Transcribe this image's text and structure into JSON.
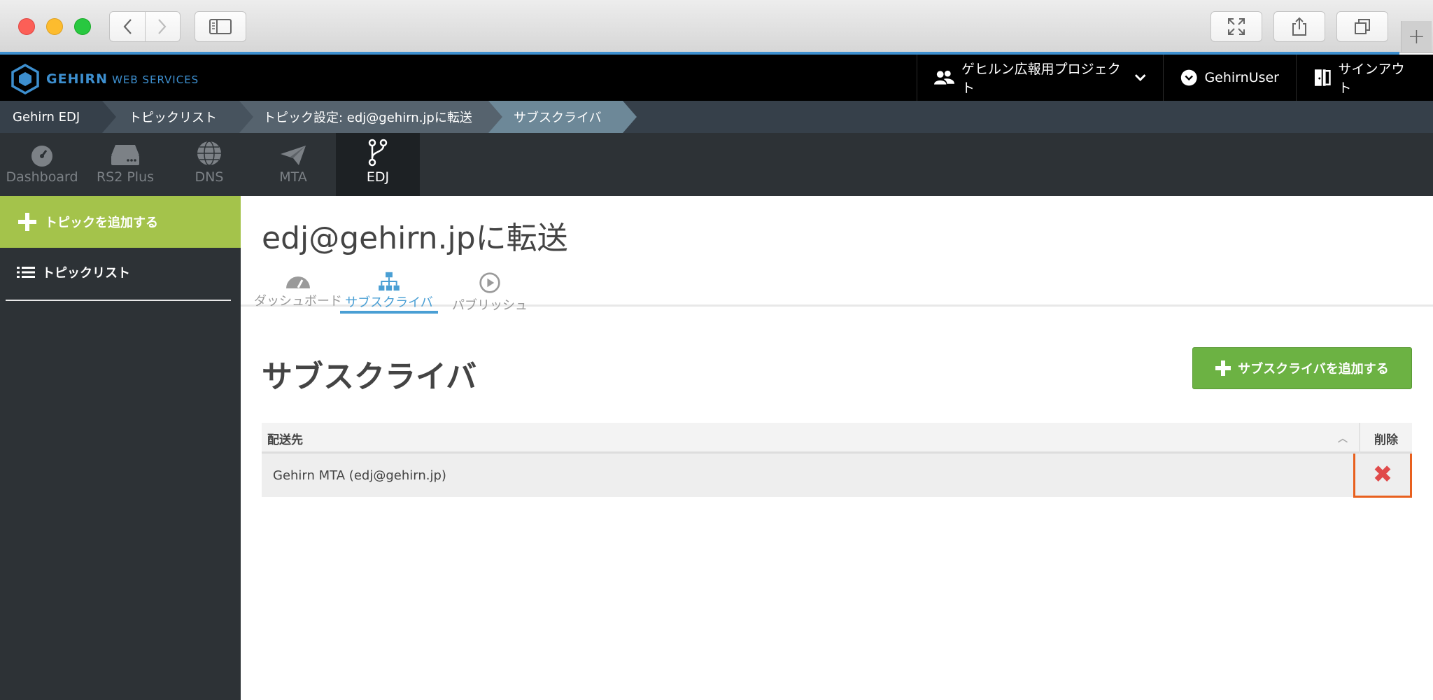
{
  "header": {
    "logo_brand": "GEHIRN",
    "logo_sub": "WEB SERVICES",
    "project": "ゲヒルン広報用プロジェクト",
    "user": "GehirnUser",
    "signout": "サインアウト"
  },
  "breadcrumb": [
    "Gehirn EDJ",
    "トピックリスト",
    "トピック設定: edj@gehirn.jpに転送",
    "サブスクライバ"
  ],
  "services": [
    {
      "label": "Dashboard",
      "icon": "gauge-icon"
    },
    {
      "label": "RS2 Plus",
      "icon": "server-icon"
    },
    {
      "label": "DNS",
      "icon": "globe-icon"
    },
    {
      "label": "MTA",
      "icon": "paper-plane-icon"
    },
    {
      "label": "EDJ",
      "icon": "branch-icon",
      "active": true
    }
  ],
  "sidebar": {
    "add_topic": "トピックを追加する",
    "topic_list": "トピックリスト"
  },
  "main": {
    "title": "edj@gehirn.jpに転送",
    "tabs": [
      {
        "label": "ダッシュボード"
      },
      {
        "label": "サブスクライバ",
        "active": true
      },
      {
        "label": "パブリッシュ"
      }
    ],
    "section_title": "サブスクライバ",
    "add_button": "サブスクライバを追加する",
    "table": {
      "headers": [
        "配送先",
        "削除"
      ],
      "rows": [
        {
          "destination": "Gehirn MTA (edj@gehirn.jp)",
          "delete": "✖"
        }
      ]
    }
  },
  "colors": {
    "accent_green": "#a4c34b",
    "button_green": "#6cb243",
    "active_tab_blue": "#4a9fd4",
    "delete_red": "#e04b4b",
    "highlight_orange": "#e8601e"
  }
}
